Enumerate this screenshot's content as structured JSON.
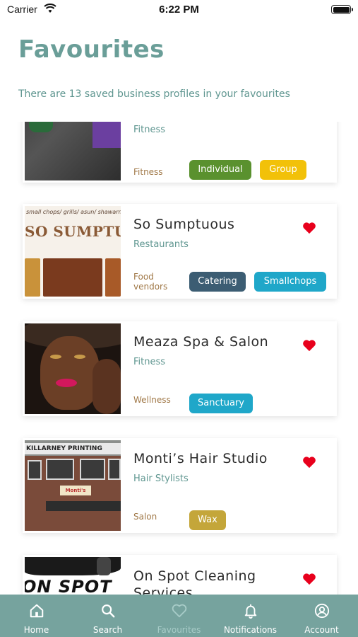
{
  "status_bar": {
    "carrier": "Carrier",
    "time": "6:22 PM"
  },
  "header": {
    "title": "Favourites",
    "subtitle": "There are 13 saved business profiles in your favourites"
  },
  "colors": {
    "accent": "#6a9e98",
    "tab_bar": "#76a39e",
    "heart": "#e8001c",
    "tag_label": "#a07847"
  },
  "favourites": [
    {
      "name": "",
      "category": "Fitness",
      "tag_label": "Fitness",
      "chips": [
        {
          "label": "Individual",
          "color": "#5a912e"
        },
        {
          "label": "Group",
          "color": "#f2c109"
        }
      ]
    },
    {
      "name": "So Sumptuous",
      "category": "Restaurants",
      "tag_label": "Food vendors",
      "favourited": true,
      "thumb_text": {
        "top": "small chops/ grills/ asun/ shawarma",
        "main": "SO SUMPTUOUS"
      },
      "chips": [
        {
          "label": "Catering",
          "color": "#3c5d73"
        },
        {
          "label": "Smallchops",
          "color": "#1fa7c9"
        }
      ]
    },
    {
      "name": "Meaza Spa & Salon",
      "category": "Fitness",
      "tag_label": "Wellness",
      "favourited": true,
      "chips": [
        {
          "label": "Sanctuary",
          "color": "#1fa7c9"
        }
      ]
    },
    {
      "name": "Monti’s Hair Studio",
      "category": "Hair Stylists",
      "tag_label": "Salon",
      "favourited": true,
      "thumb_text": {
        "sign": "KILLARNEY PRINTING",
        "shop": "Monti's"
      },
      "chips": [
        {
          "label": "Wax",
          "color": "#c4a63a"
        }
      ]
    },
    {
      "name": "On Spot Cleaning Services",
      "category": "",
      "favourited": true,
      "thumb_text": {
        "main": "ON SPOT"
      },
      "chips": []
    }
  ],
  "tab_bar": {
    "items": [
      {
        "label": "Home",
        "icon": "home-icon"
      },
      {
        "label": "Search",
        "icon": "search-icon"
      },
      {
        "label": "Favourites",
        "icon": "heart-icon",
        "active": true
      },
      {
        "label": "Notifications",
        "icon": "bell-icon"
      },
      {
        "label": "Account",
        "icon": "account-icon"
      }
    ]
  }
}
